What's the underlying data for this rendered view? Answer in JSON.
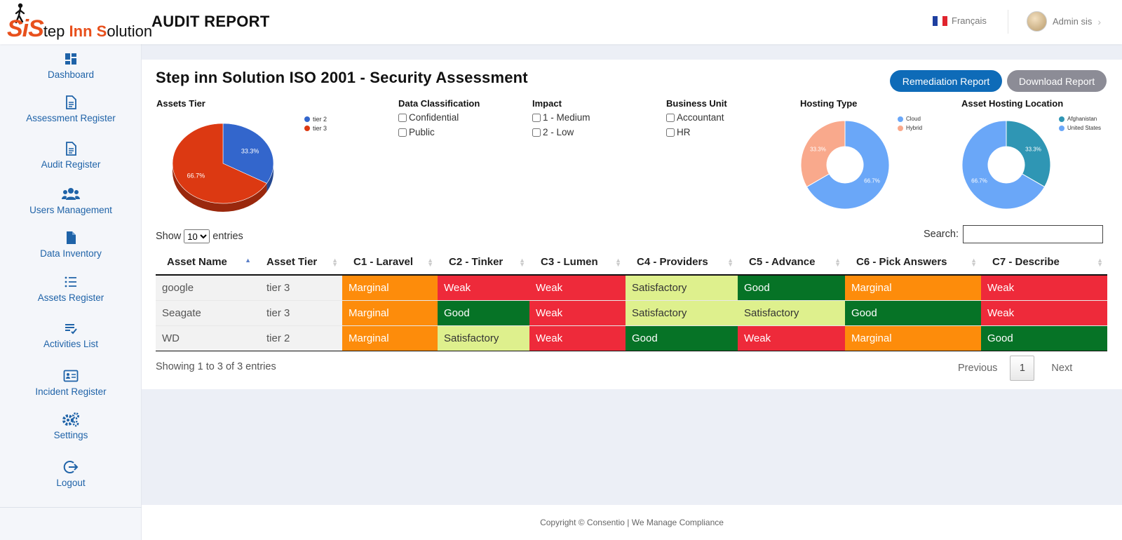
{
  "topbar": {
    "logo_si": "SiS",
    "logo_step": "tep ",
    "logo_inn": "Inn ",
    "logo_solution": "olution",
    "page_heading": "AUDIT REPORT",
    "language": "Français",
    "flag_colors": [
      "#1e3fa0",
      "#ffffff",
      "#e0242e"
    ],
    "user_name": "Admin sis"
  },
  "sidebar": {
    "items": [
      {
        "label": "Dashboard",
        "icon": "dashboard-icon"
      },
      {
        "label": "Assessment Register",
        "icon": "document-icon"
      },
      {
        "label": "Audit Register",
        "icon": "document-icon"
      },
      {
        "label": "Users Management",
        "icon": "users-icon"
      },
      {
        "label": "Data Inventory",
        "icon": "file-icon"
      },
      {
        "label": "Assets Register",
        "icon": "list-icon"
      },
      {
        "label": "Activities List",
        "icon": "checklist-icon"
      },
      {
        "label": "Incident Register",
        "icon": "id-card-icon"
      },
      {
        "label": "Settings",
        "icon": "gears-icon"
      },
      {
        "label": "Logout",
        "icon": "logout-icon"
      }
    ]
  },
  "report": {
    "title": "Step inn Solution ISO 2001 - Security Assessment",
    "remediation_button": "Remediation Report",
    "download_button": "Download Report"
  },
  "filters": {
    "data_classification": {
      "label": "Data Classification",
      "options": [
        "Confidential",
        "Public"
      ]
    },
    "impact": {
      "label": "Impact",
      "options": [
        "1 - Medium",
        "2 - Low"
      ]
    },
    "business_unit": {
      "label": "Business Unit",
      "options": [
        "Accountant",
        "HR"
      ]
    }
  },
  "chart_data": [
    {
      "type": "pie",
      "title": "Assets Tier",
      "categories": [
        "tier 2",
        "tier 3"
      ],
      "values": [
        33.3,
        66.7
      ],
      "labels": [
        "33.3%",
        "66.7%"
      ],
      "colors": [
        "#3366cc",
        "#dc3912"
      ],
      "legend": "right"
    },
    {
      "type": "pie",
      "title": "Hosting Type",
      "categories": [
        "Cloud",
        "Hybrid"
      ],
      "values": [
        66.7,
        33.3
      ],
      "labels": [
        "66.7%",
        "33.3%"
      ],
      "colors": [
        "#6aa7f8",
        "#f9a98c"
      ],
      "legend": "right",
      "donut": true
    },
    {
      "type": "pie",
      "title": "Asset Hosting Location",
      "categories": [
        "Afghanistan",
        "United States"
      ],
      "values": [
        33.3,
        66.7
      ],
      "labels": [
        "33.3%",
        "66.7%"
      ],
      "colors": [
        "#2f96b4",
        "#6aa7f8"
      ],
      "legend": "right",
      "donut": true
    }
  ],
  "table": {
    "show_label": "Show",
    "page_size": "10",
    "page_size_options": [
      "10"
    ],
    "entries_label": "entries",
    "search_label": "Search:",
    "search_value": "",
    "columns": [
      "Asset Name",
      "Asset Tier",
      "C1 - Laravel",
      "C2 - Tinker",
      "C3 - Lumen",
      "C4 - Providers",
      "C5 - Advance",
      "C6 - Pick Answers",
      "C7 - Describe"
    ],
    "rows": [
      [
        "google",
        "tier 3",
        "Marginal",
        "Weak",
        "Weak",
        "Satisfactory",
        "Good",
        "Marginal",
        "Weak"
      ],
      [
        "Seagate",
        "tier 3",
        "Marginal",
        "Good",
        "Weak",
        "Satisfactory",
        "Satisfactory",
        "Good",
        "Weak"
      ],
      [
        "WD",
        "tier 2",
        "Marginal",
        "Satisfactory",
        "Weak",
        "Good",
        "Weak",
        "Marginal",
        "Good"
      ]
    ],
    "rating_colors": {
      "Marginal": "#fd8c0b",
      "Weak": "#ee2a3a",
      "Good": "#067326",
      "Satisfactory": "#def08d"
    },
    "info": "Showing 1 to 3 of 3 entries",
    "previous": "Previous",
    "current_page": "1",
    "next": "Next"
  },
  "footer": {
    "text": "Copyright © Consentio | We Manage Compliance"
  }
}
